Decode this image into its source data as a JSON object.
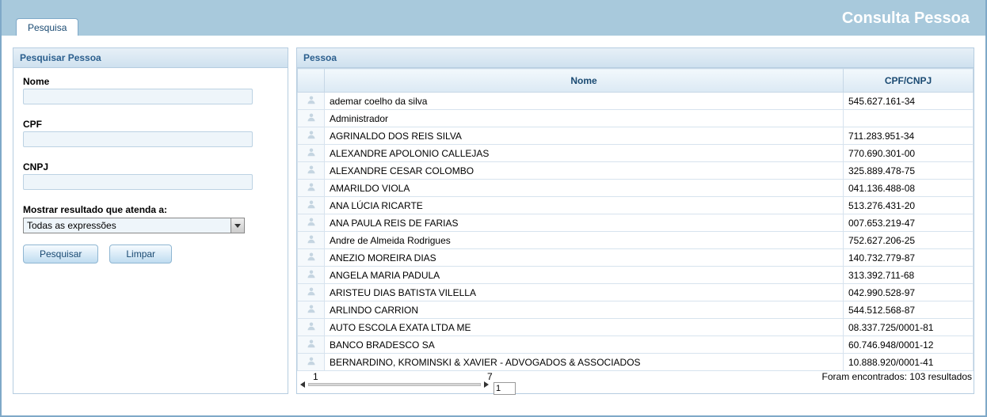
{
  "header": {
    "tab_label": "Pesquisa",
    "page_title": "Consulta Pessoa"
  },
  "search": {
    "panel_title": "Pesquisar Pessoa",
    "nome_label": "Nome",
    "nome_value": "",
    "cpf_label": "CPF",
    "cpf_value": "",
    "cnpj_label": "CNPJ",
    "cnpj_value": "",
    "filter_label": "Mostrar resultado que atenda a:",
    "filter_selected": "Todas as expressões",
    "btn_search": "Pesquisar",
    "btn_clear": "Limpar"
  },
  "results": {
    "panel_title": "Pessoa",
    "col_nome": "Nome",
    "col_doc": "CPF/CNPJ",
    "rows": [
      {
        "nome": "ademar coelho da silva",
        "doc": "545.627.161-34"
      },
      {
        "nome": "Administrador",
        "doc": ""
      },
      {
        "nome": "AGRINALDO DOS REIS SILVA",
        "doc": "711.283.951-34"
      },
      {
        "nome": "ALEXANDRE APOLONIO CALLEJAS",
        "doc": "770.690.301-00"
      },
      {
        "nome": "ALEXANDRE CESAR COLOMBO",
        "doc": "325.889.478-75"
      },
      {
        "nome": "AMARILDO VIOLA",
        "doc": "041.136.488-08"
      },
      {
        "nome": "ANA LÚCIA RICARTE",
        "doc": "513.276.431-20"
      },
      {
        "nome": "ANA PAULA REIS DE FARIAS",
        "doc": "007.653.219-47"
      },
      {
        "nome": "Andre de Almeida Rodrigues",
        "doc": "752.627.206-25"
      },
      {
        "nome": "ANEZIO MOREIRA DIAS",
        "doc": "140.732.779-87"
      },
      {
        "nome": "ANGELA MARIA PADULA",
        "doc": "313.392.711-68"
      },
      {
        "nome": "ARISTEU DIAS BATISTA VILELLA",
        "doc": "042.990.528-97"
      },
      {
        "nome": "ARLINDO CARRION",
        "doc": "544.512.568-87"
      },
      {
        "nome": "AUTO ESCOLA EXATA LTDA ME",
        "doc": "08.337.725/0001-81"
      },
      {
        "nome": "BANCO BRADESCO SA",
        "doc": "60.746.948/0001-12"
      },
      {
        "nome": "BERNARDINO, KROMINSKI & XAVIER - ADVOGADOS & ASSOCIADOS",
        "doc": "10.888.920/0001-41"
      }
    ],
    "pager": {
      "current_page": "1",
      "total_pages": "7",
      "input_value": "1",
      "status": "Foram encontrados: 103 resultados"
    }
  }
}
